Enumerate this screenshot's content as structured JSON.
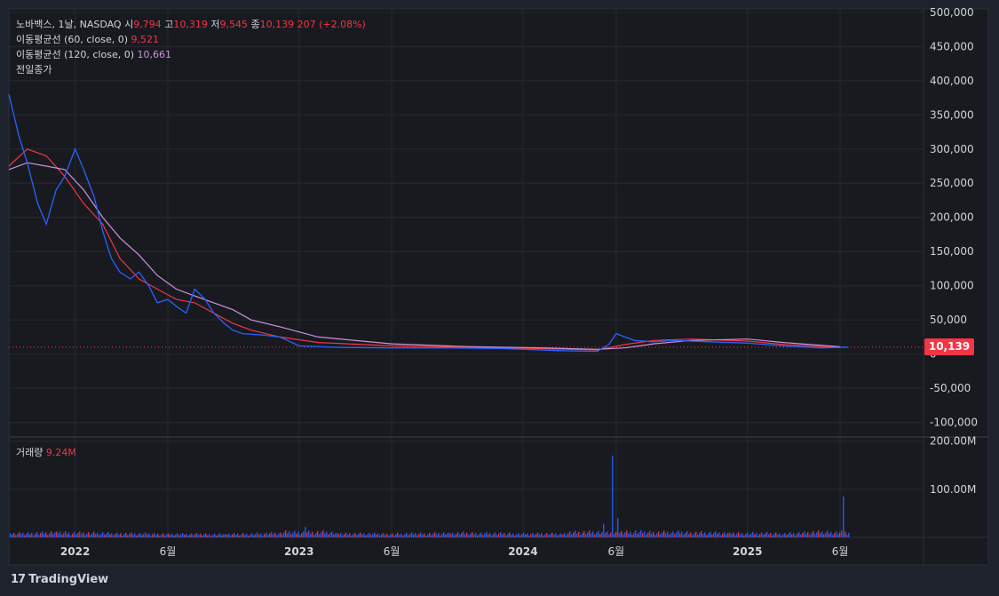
{
  "legend": {
    "name": "노바백스, 1날, NASDAQ",
    "open_label": "시",
    "open": "9,794",
    "high_label": "고",
    "high": "10,319",
    "low_label": "저",
    "low": "9,545",
    "close_label": "종",
    "close": "10,139",
    "change": "207 (+2.08%)",
    "ma60_label": "이동평균선 (60, close, 0)",
    "ma60_value": "9,521",
    "ma120_label": "이동평균선 (120, close, 0)",
    "ma120_value": "10,661",
    "prev_close_label": "전일종가"
  },
  "volume_legend": {
    "label": "거래량",
    "value": "9.24M"
  },
  "last_price_badge": "10,139",
  "brand": {
    "logo": "17",
    "name": "TradingView"
  },
  "colors": {
    "up": "#f23645",
    "down": "#2962ff",
    "ma60": "#f23645",
    "ma120": "#ce93d8",
    "background": "#1e222d"
  },
  "chart_data": {
    "type": "line",
    "price_axis_ticks": [
      "500,000",
      "450,000",
      "400,000",
      "350,000",
      "300,000",
      "250,000",
      "200,000",
      "150,000",
      "100,000",
      "50,000",
      "0",
      "-50,000",
      "-100,000"
    ],
    "price_axis_values": [
      500000,
      450000,
      400000,
      350000,
      300000,
      250000,
      200000,
      150000,
      100000,
      50000,
      0,
      -50000,
      -100000
    ],
    "volume_axis_ticks": [
      "200.00M",
      "100.00M"
    ],
    "volume_axis_values": [
      200000000,
      100000000
    ],
    "time_ticks": [
      "2022",
      "6월",
      "2023",
      "6월",
      "2024",
      "6월",
      "2025",
      "6월"
    ],
    "time_tick_dates": [
      "2022-01-01",
      "2022-06-01",
      "2023-01-01",
      "2023-06-01",
      "2024-01-01",
      "2024-06-01",
      "2025-01-01",
      "2025-06-01"
    ],
    "xlim": [
      "2021-09-15",
      "2025-10-15"
    ],
    "ylim": [
      -120000,
      505000
    ],
    "volume_ylim": [
      0,
      205000000
    ],
    "grid": true,
    "series": [
      {
        "name": "이동평균선 (60, close, 0)",
        "color": "#f23645",
        "x": [
          "2021-09-15",
          "2021-10-15",
          "2021-11-15",
          "2021-12-15",
          "2022-01-15",
          "2022-02-15",
          "2022-03-15",
          "2022-04-15",
          "2022-05-15",
          "2022-06-15",
          "2022-07-15",
          "2022-08-15",
          "2022-09-15",
          "2022-10-15",
          "2022-12-01",
          "2023-02-01",
          "2023-06-01",
          "2023-10-01",
          "2024-02-01",
          "2024-05-01",
          "2024-06-15",
          "2024-08-01",
          "2024-10-01",
          "2025-01-01",
          "2025-03-01",
          "2025-06-01"
        ],
        "values": [
          275000,
          300000,
          290000,
          260000,
          220000,
          190000,
          140000,
          110000,
          95000,
          80000,
          75000,
          60000,
          45000,
          35000,
          25000,
          17000,
          12000,
          10000,
          8000,
          6000,
          14000,
          20000,
          22000,
          19000,
          14000,
          9521
        ]
      },
      {
        "name": "이동평균선 (120, close, 0)",
        "color": "#ce93d8",
        "x": [
          "2021-09-15",
          "2021-10-15",
          "2021-11-15",
          "2021-12-15",
          "2022-01-15",
          "2022-02-15",
          "2022-03-15",
          "2022-04-15",
          "2022-05-15",
          "2022-06-15",
          "2022-07-15",
          "2022-08-15",
          "2022-09-15",
          "2022-10-15",
          "2022-12-01",
          "2023-02-01",
          "2023-06-01",
          "2023-10-01",
          "2024-02-01",
          "2024-05-01",
          "2024-06-15",
          "2024-08-01",
          "2024-10-01",
          "2025-01-01",
          "2025-03-01",
          "2025-06-01"
        ],
        "values": [
          270000,
          280000,
          275000,
          270000,
          240000,
          200000,
          170000,
          145000,
          115000,
          95000,
          85000,
          75000,
          65000,
          50000,
          40000,
          25000,
          15000,
          11000,
          9000,
          7000,
          9000,
          15000,
          20000,
          22000,
          17000,
          10661
        ]
      },
      {
        "name": "price",
        "color": "#2962ff",
        "x": [
          "2021-09-15",
          "2021-10-01",
          "2021-10-15",
          "2021-11-01",
          "2021-11-15",
          "2021-12-01",
          "2021-12-15",
          "2022-01-01",
          "2022-01-15",
          "2022-02-01",
          "2022-02-15",
          "2022-03-01",
          "2022-03-15",
          "2022-04-01",
          "2022-04-15",
          "2022-05-01",
          "2022-05-15",
          "2022-06-01",
          "2022-06-15",
          "2022-07-01",
          "2022-07-15",
          "2022-08-01",
          "2022-08-15",
          "2022-09-01",
          "2022-09-15",
          "2022-10-01",
          "2022-11-01",
          "2022-12-01",
          "2023-01-01",
          "2023-03-01",
          "2023-06-01",
          "2023-09-01",
          "2023-12-01",
          "2024-03-01",
          "2024-05-01",
          "2024-05-20",
          "2024-06-01",
          "2024-06-15",
          "2024-07-01",
          "2024-08-01",
          "2024-09-01",
          "2024-11-01",
          "2025-01-01",
          "2025-03-01",
          "2025-05-01",
          "2025-06-15"
        ],
        "values": [
          380000,
          320000,
          280000,
          220000,
          190000,
          240000,
          260000,
          300000,
          270000,
          230000,
          180000,
          140000,
          120000,
          110000,
          120000,
          100000,
          75000,
          80000,
          70000,
          60000,
          95000,
          80000,
          60000,
          45000,
          35000,
          30000,
          28000,
          25000,
          12000,
          10000,
          9000,
          9000,
          8000,
          5000,
          4000,
          14000,
          30000,
          25000,
          20000,
          18000,
          20000,
          18000,
          16000,
          12000,
          9000,
          10139
        ]
      }
    ],
    "volume": {
      "x": [
        "2021-09-15",
        "2021-12-01",
        "2022-03-01",
        "2022-06-01",
        "2022-09-01",
        "2022-12-01",
        "2023-01-10",
        "2023-03-01",
        "2023-06-01",
        "2023-09-01",
        "2023-12-01",
        "2024-03-01",
        "2024-05-10",
        "2024-05-23",
        "2024-06-01",
        "2024-07-01",
        "2024-09-01",
        "2024-12-01",
        "2025-03-01",
        "2025-05-01",
        "2025-06-05",
        "2025-06-15"
      ],
      "values": [
        8000000,
        12000000,
        9000000,
        8000000,
        7000000,
        10000000,
        22000000,
        9000000,
        8000000,
        10000000,
        9000000,
        8000000,
        28000000,
        170000000,
        40000000,
        15000000,
        12000000,
        10000000,
        9000000,
        12000000,
        85000000,
        9240000
      ]
    }
  }
}
